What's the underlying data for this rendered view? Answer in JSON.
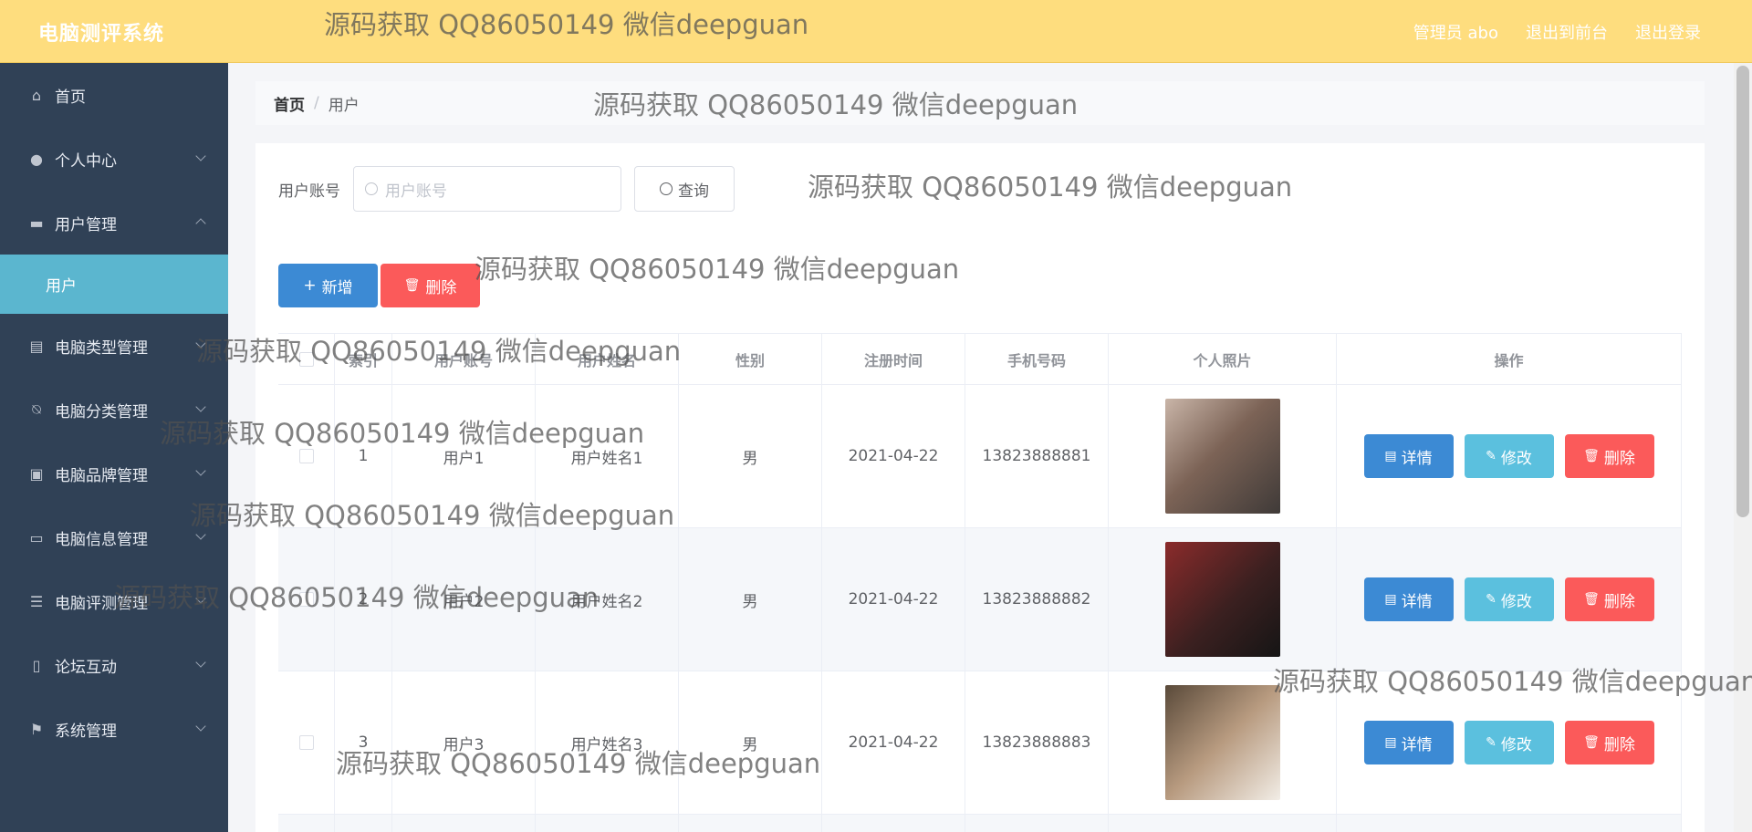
{
  "header": {
    "brand": "电脑测评系统",
    "admin": "管理员 abo",
    "to_front": "退出到前台",
    "logout": "退出登录"
  },
  "sidebar": {
    "items": [
      {
        "label": "首页",
        "icon": "home-icon"
      },
      {
        "label": "个人中心",
        "icon": "user-icon"
      },
      {
        "label": "用户管理",
        "icon": "chat-icon",
        "expanded": true
      },
      {
        "label": "电脑类型管理",
        "icon": "clipboard-icon"
      },
      {
        "label": "电脑分类管理",
        "icon": "bell-off-icon"
      },
      {
        "label": "电脑品牌管理",
        "icon": "briefcase-icon"
      },
      {
        "label": "电脑信息管理",
        "icon": "card-icon"
      },
      {
        "label": "电脑评测管理",
        "icon": "list-icon"
      },
      {
        "label": "论坛互动",
        "icon": "phone-icon"
      },
      {
        "label": "系统管理",
        "icon": "flag-icon"
      }
    ],
    "sub_item": "用户"
  },
  "breadcrumb": {
    "home": "首页",
    "sep": "/",
    "current": "用户"
  },
  "search": {
    "label": "用户账号",
    "placeholder": "用户账号",
    "button": "查询"
  },
  "actions": {
    "add": "新增",
    "delete": "删除"
  },
  "table": {
    "headers": [
      "",
      "索引",
      "用户账号",
      "用户姓名",
      "性别",
      "注册时间",
      "手机号码",
      "个人照片",
      "操作"
    ],
    "rows": [
      {
        "index": "1",
        "account": "用户1",
        "name": "用户姓名1",
        "sex": "男",
        "date": "2021-04-22",
        "phone": "13823888881"
      },
      {
        "index": "2",
        "account": "用户2",
        "name": "用户姓名2",
        "sex": "男",
        "date": "2021-04-22",
        "phone": "13823888882"
      },
      {
        "index": "3",
        "account": "用户3",
        "name": "用户姓名3",
        "sex": "男",
        "date": "2021-04-22",
        "phone": "13823888883"
      }
    ],
    "op": {
      "detail": "详情",
      "edit": "修改",
      "delete": "删除"
    }
  },
  "watermark": "源码获取 QQ86050149 微信deepguan"
}
